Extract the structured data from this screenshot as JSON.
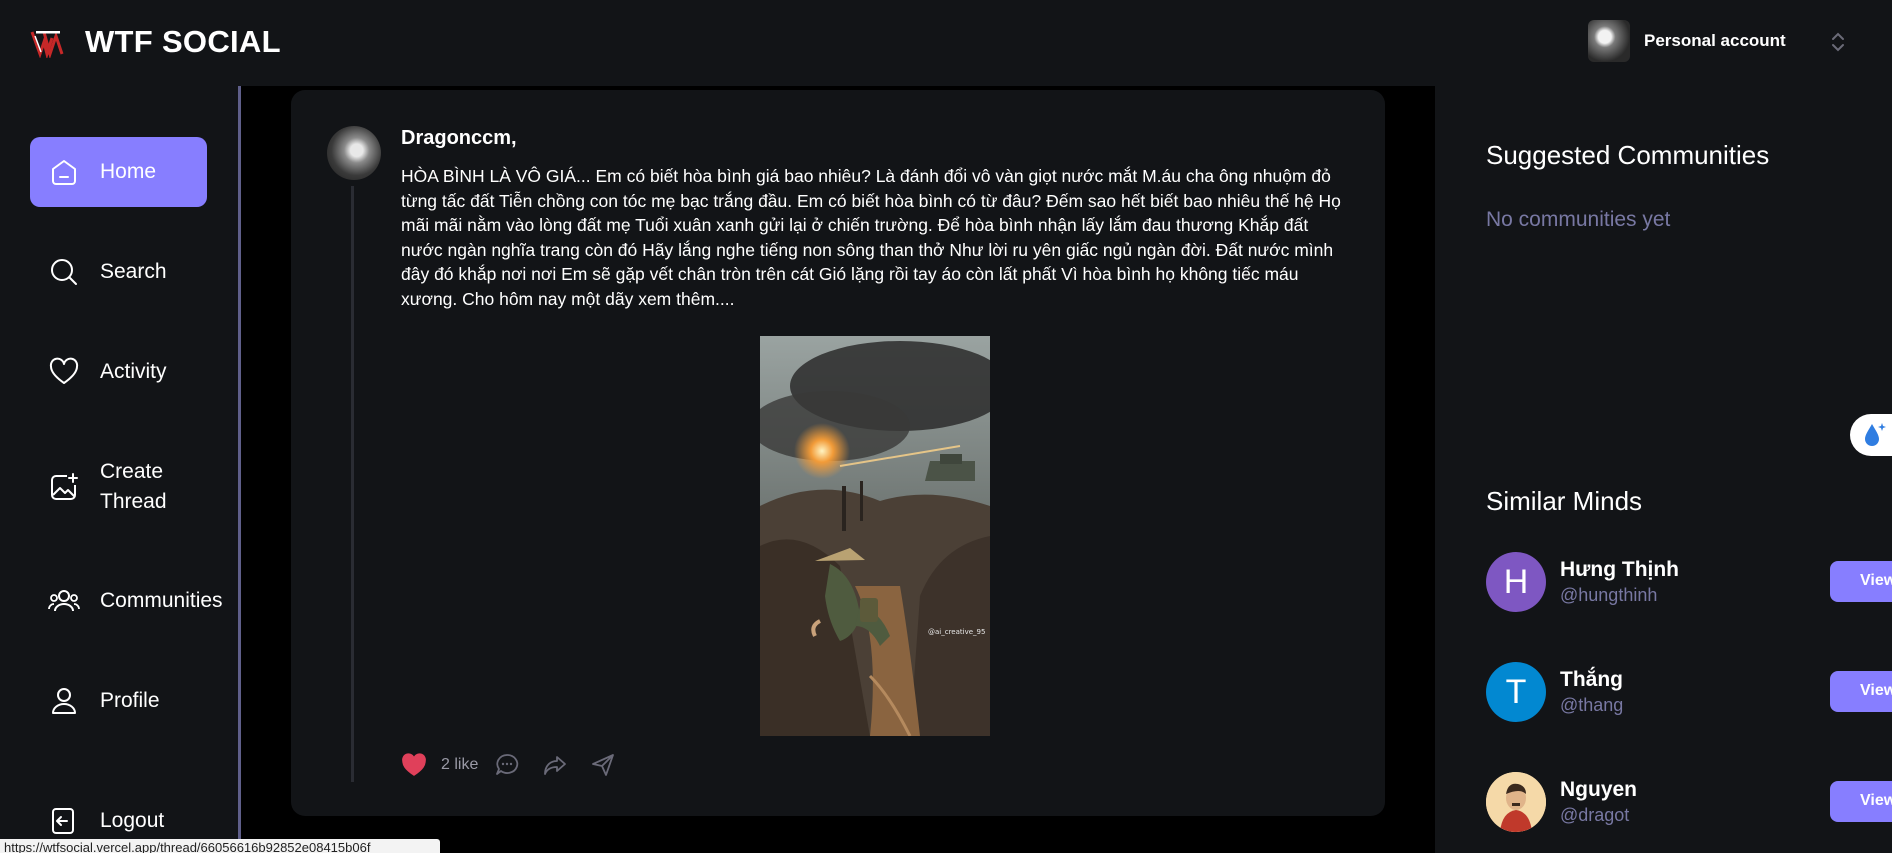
{
  "header": {
    "app_title": "WTF SOCIAL",
    "logo_letter": "W",
    "account_label": "Personal account"
  },
  "sidebar": {
    "items": [
      {
        "label": "Home",
        "icon": "home-icon",
        "active": true
      },
      {
        "label": "Search",
        "icon": "search-icon",
        "active": false
      },
      {
        "label": "Activity",
        "icon": "heart-icon",
        "active": false
      },
      {
        "label": "Create Thread",
        "icon": "image-plus-icon",
        "active": false
      },
      {
        "label": "Communities",
        "icon": "users-icon",
        "active": false
      },
      {
        "label": "Profile",
        "icon": "user-icon",
        "active": false
      },
      {
        "label": "Logout",
        "icon": "logout-icon",
        "active": false
      }
    ]
  },
  "post": {
    "author": "Dragonccm,",
    "text": "HÒA BÌNH LÀ VÔ GIÁ... Em có biết hòa bình giá bao nhiêu? Là đánh đổi vô vàn giọt nước mắt M.áu cha ông nhuộm đỏ từng tấc đất Tiễn chồng con tóc mẹ bạc trắng đầu. Em có biết hòa bình có từ đâu? Đếm sao hết biết bao nhiêu thế hệ Họ mãi mãi nằm vào lòng đất mẹ Tuổi xuân xanh gửi lại ở chiến trường. Để hòa bình nhận lấy lắm đau thương Khắp đất nước ngàn nghĩa trang còn đó Hãy lắng nghe tiếng non sông than thở Như lời ru yên giấc ngủ ngàn đời. Đất nước mình đây đó khắp nơi nơi Em sẽ gặp vết chân tròn trên cát Gió lặng rồi tay áo còn lất phất Vì hòa bình họ không tiếc máu xương. Cho hôm nay một dãy xem thêm....",
    "image_watermark": "@ai_creative_95",
    "like_label": "2 like",
    "liked": true
  },
  "right": {
    "communities_title": "Suggested Communities",
    "communities_empty": "No communities yet",
    "minds_title": "Similar Minds",
    "users": [
      {
        "initial": "H",
        "name": "Hưng Thịnh",
        "handle": "@hungthinh",
        "color": "#7e57c2",
        "button": "View"
      },
      {
        "initial": "T",
        "name": "Thắng",
        "handle": "@thang",
        "color": "#0288d1",
        "button": "View"
      },
      {
        "initial": "",
        "name": "Nguyen",
        "handle": "@dragot",
        "color": "#f5d9a8",
        "button": "View"
      }
    ]
  },
  "colors": {
    "accent": "#877eff",
    "panel": "#121417",
    "muted": "#7878a3",
    "like": "#e0405a"
  },
  "status_bar": {
    "url": "https://wtfsocial.vercel.app/thread/66056616b92852e08415b06f"
  }
}
